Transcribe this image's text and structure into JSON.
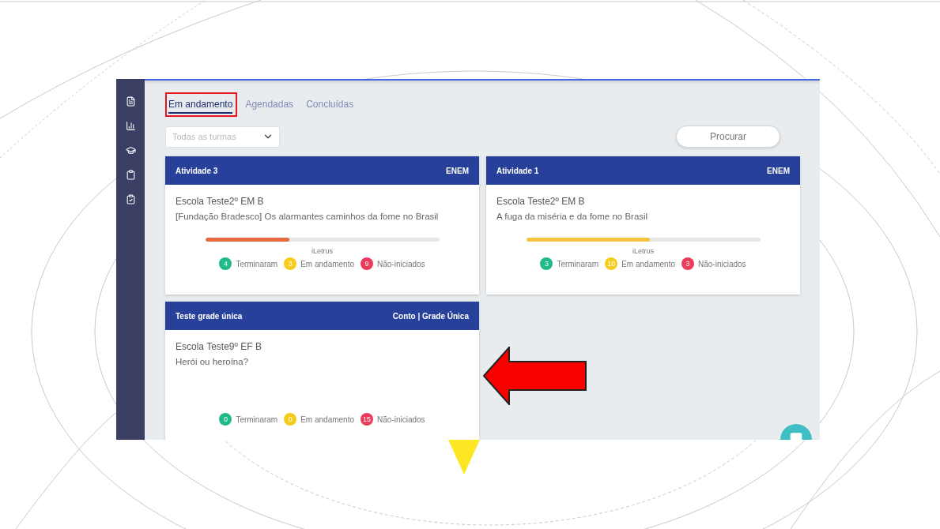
{
  "tabs": [
    {
      "label": "Em andamento",
      "selected": true,
      "highlighted": true
    },
    {
      "label": "Agendadas",
      "selected": false,
      "highlighted": false
    },
    {
      "label": "Concluídas",
      "selected": false,
      "highlighted": false
    }
  ],
  "class_filter": {
    "placeholder": "Todas as turmas"
  },
  "search_button": "Procurar",
  "cards": [
    {
      "title": "Atividade 3",
      "tag": "ENEM",
      "school": "Escola Teste2º EM B",
      "activity": "[Fundação Bradesco] Os alarmantes caminhos da fome no Brasil",
      "progress": {
        "level": 0.36,
        "color": "#e8683f",
        "label": "iLetrus"
      },
      "stats": [
        {
          "count": "4",
          "label": "Terminaram",
          "color": "#1fb98a"
        },
        {
          "count": "3",
          "label": "Em andamento",
          "color": "#f5cc1c"
        },
        {
          "count": "9",
          "label": "Não-iniciados",
          "color": "#ec3a5a"
        }
      ]
    },
    {
      "title": "Atividade 1",
      "tag": "ENEM",
      "school": "Escola Teste2º EM B",
      "activity": "A fuga da miséria e da fome no Brasil",
      "progress": {
        "level": 0.53,
        "color": "#f5c53d",
        "label": "iLetrus"
      },
      "stats": [
        {
          "count": "3",
          "label": "Terminaram",
          "color": "#1fb98a"
        },
        {
          "count": "10",
          "label": "Em andamento",
          "color": "#f5cc1c"
        },
        {
          "count": "3",
          "label": "Não-iniciados",
          "color": "#ec3a5a"
        }
      ]
    },
    {
      "title": "Teste grade única",
      "tag": "Conto | Grade Única",
      "school": "Escola Teste9º EF B",
      "activity": "Herói ou heroína?",
      "stats": [
        {
          "count": "0",
          "label": "Terminaram",
          "color": "#1fb98a"
        },
        {
          "count": "0",
          "label": "Em andamento",
          "color": "#f5cc1c"
        },
        {
          "count": "15",
          "label": "Não-iniciados",
          "color": "#ec3a5a"
        }
      ]
    }
  ]
}
